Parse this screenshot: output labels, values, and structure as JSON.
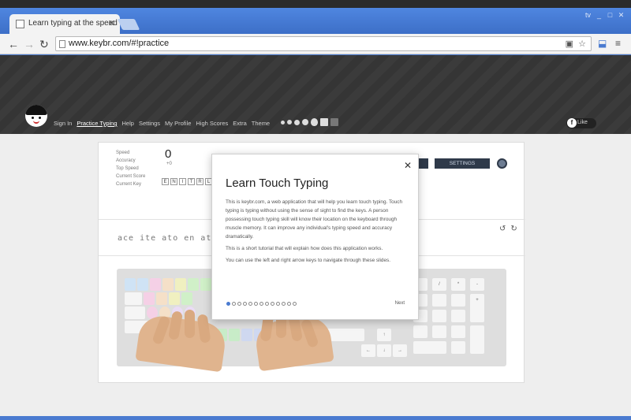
{
  "browser": {
    "tab_title": "Learn typing at the speed",
    "url": "www.keybr.com/#!practice",
    "window_controls": [
      "tv",
      "_",
      "□",
      "✕"
    ]
  },
  "site": {
    "nav": [
      "Sign In",
      "Practice Typing",
      "Help",
      "Settings",
      "My Profile",
      "High Scores",
      "Extra",
      "Theme"
    ],
    "active_nav": "Practice Typing",
    "facebook_label": "Like"
  },
  "practice": {
    "stats_labels": [
      "Speed",
      "Accuracy",
      "Top Speed",
      "Current Score",
      "Current Key"
    ],
    "wpm_value": "0",
    "wpm_delta": "+0",
    "settings_label": "SETTINGS",
    "text": "ace ite ato en                                    at tent"
  },
  "modal": {
    "title": "Learn Touch Typing",
    "paragraphs": [
      "This is keybr.com, a web application that will help you learn touch typing. Touch typing is typing without using the sense of sight to find the keys. A person possessing touch typing skill will know their location on the keyboard through muscle memory. It can improve any individual's typing speed and accuracy dramatically.",
      "This is a short tutorial that will explain how does this application works.",
      "You can use the left and right arrow keys to navigate through these slides."
    ],
    "slides_total": 13,
    "slide_current": 1,
    "next_label": "Next"
  },
  "colors": {
    "chrome_blue": "#4a7bd0",
    "settings_bg": "#2f3a4a"
  }
}
